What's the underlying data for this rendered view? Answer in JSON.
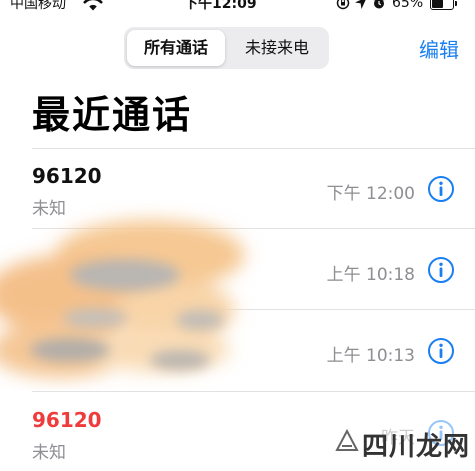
{
  "status_bar": {
    "carrier": "中国移动",
    "time": "下午12:09",
    "battery_percent": "65%",
    "battery_level": 0.65,
    "icons": [
      "wifi-icon",
      "screen-rotation-lock-icon",
      "location-arrow-icon",
      "alarm-icon",
      "battery-icon"
    ]
  },
  "header": {
    "segments": [
      "所有通话",
      "未接来电"
    ],
    "selected_segment": "所有通话",
    "edit_label": "编辑",
    "title": "最近通话"
  },
  "calls": [
    {
      "number": "96120",
      "label": "未知",
      "time": "下午 12:00",
      "missed": false
    },
    {
      "number": "",
      "label": "",
      "time": "上午 10:18",
      "missed": false
    },
    {
      "number": "",
      "label": "",
      "time": "上午 10:13",
      "missed": false
    },
    {
      "number": "96120",
      "label": "未知",
      "time": "昨天",
      "missed": true
    }
  ],
  "watermark": {
    "text": "四川龙网"
  },
  "colors": {
    "accent": "#1a7ff0",
    "missed": "#ef3b3b",
    "secondary_text": "#8e8e93"
  }
}
